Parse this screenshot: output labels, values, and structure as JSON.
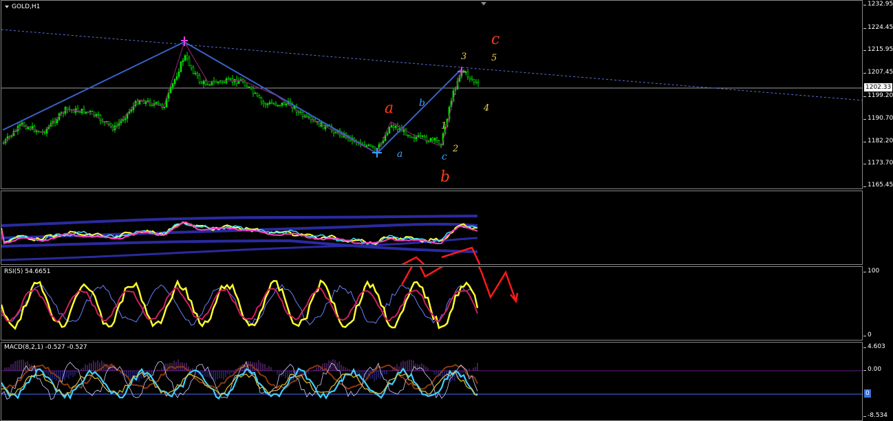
{
  "symbol_title": "GOLD,H1",
  "price_scale": [
    "1232.95",
    "1224.45",
    "1215.95",
    "1207.45",
    "1199.20",
    "1190.70",
    "1182.20",
    "1173.70",
    "1165.45"
  ],
  "current_price": "1202.33",
  "rsi_label": "RSI(5) 54.6651",
  "rsi_scale": [
    "100",
    "0"
  ],
  "macd_label": "MACD(8,2,1) -0.527 -0.527",
  "macd_scale": [
    "4.603",
    "0.00",
    "-8.534"
  ],
  "macd_marker": "0",
  "wave_labels": {
    "big_a": "a",
    "big_b": "b",
    "big_c": "c",
    "small_a": "a",
    "small_b": "b",
    "small_c": "c",
    "n1": "1",
    "n2": "2",
    "n3": "3",
    "n4": "4",
    "n5": "5"
  },
  "colors": {
    "candles": "#00e400",
    "trendline": "#3a62c8",
    "zigzag": "#8a1f72",
    "dash_line": "#5a6fd8",
    "wave_red": "#ff3a1a",
    "wave_yellow": "#f1d34a",
    "wave_blue": "#3aa0ff",
    "projection": "#ff1a1a"
  }
}
